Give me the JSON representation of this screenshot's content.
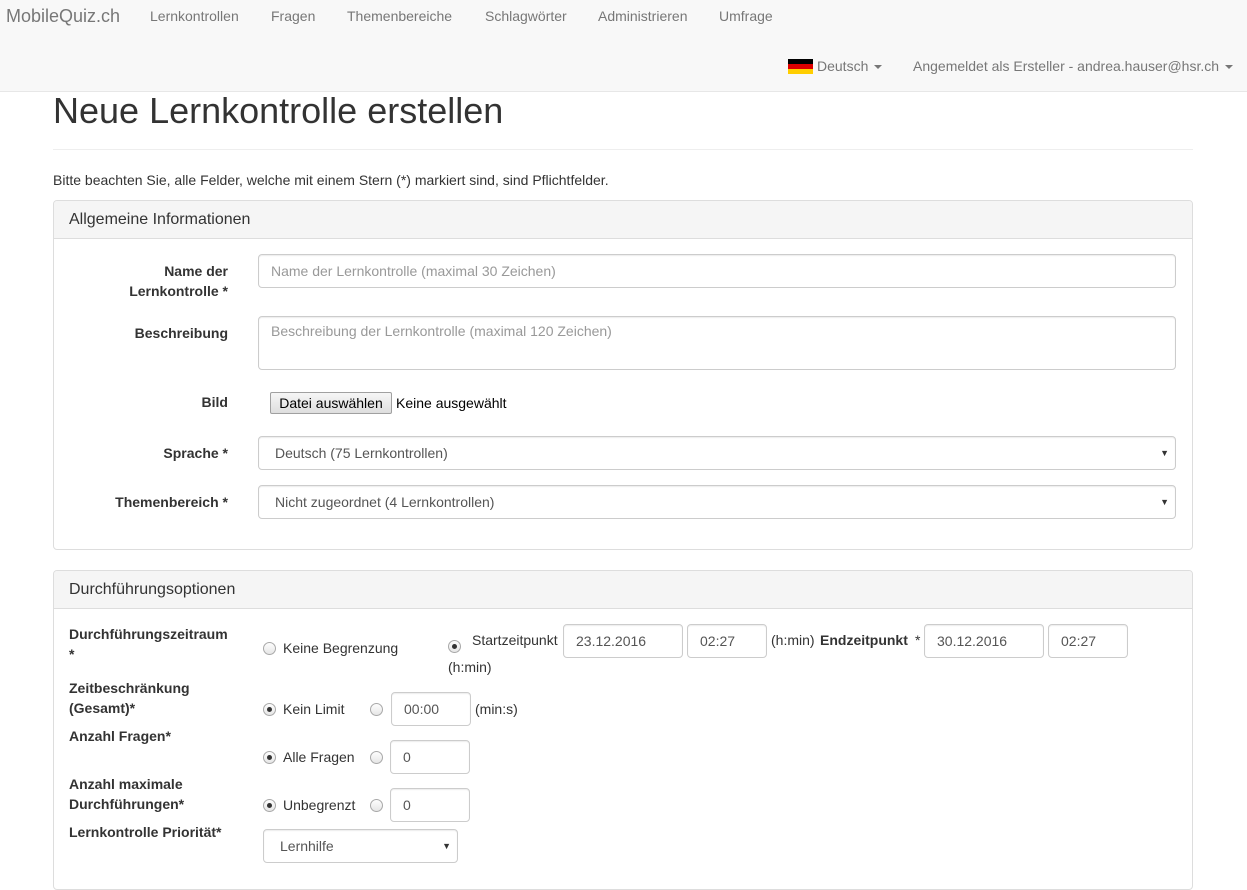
{
  "navbar": {
    "brand": "MobileQuiz.ch",
    "links": [
      "Lernkontrollen",
      "Fragen",
      "Themenbereiche",
      "Schlagwörter",
      "Administrieren",
      "Umfrage"
    ],
    "language": "Deutsch",
    "user": "Angemeldet als Ersteller - andrea.hauser@hsr.ch"
  },
  "page": {
    "title": "Neue Lernkontrolle erstellen",
    "notice": "Bitte beachten Sie, alle Felder, welche mit einem Stern (*) markiert sind, sind Pflichtfelder."
  },
  "general": {
    "heading": "Allgemeine Informationen",
    "name_label_line1": "Name der",
    "name_label_line2": "Lernkontrolle *",
    "name_placeholder": "Name der Lernkontrolle (maximal 30 Zeichen)",
    "description_label": "Beschreibung",
    "description_placeholder": "Beschreibung der Lernkontrolle (maximal 120 Zeichen)",
    "image_label": "Bild",
    "file_button": "Datei auswählen",
    "file_status": "Keine ausgewählt",
    "language_label": "Sprache *",
    "language_value": "Deutsch (75 Lernkontrollen)",
    "topic_label": "Themenbereich *",
    "topic_value": "Nicht zugeordnet (4 Lernkontrollen)"
  },
  "options": {
    "heading": "Durchführungsoptionen",
    "period_label_line1": "Durchführungszeitraum",
    "period_label_line2": "*",
    "no_limit_option": "Keine Begrenzung",
    "start_label": "Startzeitpunkt",
    "start_date": "23.12.2016",
    "start_time": "02:27",
    "hmin_1": "(h:min)",
    "end_label": "Endzeitpunkt",
    "end_star": "*",
    "end_date": "30.12.2016",
    "end_time": "02:27",
    "hmin_2": "(h:min)",
    "time_limit_label_line1": "Zeitbeschränkung",
    "time_limit_label_line2": "(Gesamt)*",
    "no_time_limit_option": "Kein Limit",
    "time_limit_value": "00:00",
    "time_limit_unit": "(min:s)",
    "question_count_label": "Anzahl Fragen*",
    "all_questions_option": "Alle Fragen",
    "question_count_value": "0",
    "max_runs_label_line1": "Anzahl maximale",
    "max_runs_label_line2": "Durchführungen*",
    "unlimited_option": "Unbegrenzt",
    "max_runs_value": "0",
    "priority_label": "Lernkontrolle Priorität*",
    "priority_value": "Lernhilfe"
  },
  "icons": {
    "flag": "flag-de-icon",
    "caret": "caret-down-icon",
    "select_arrow": "select-arrow-icon"
  },
  "colors": {
    "navbar_bg": "#f8f8f8",
    "nav_text": "#777777",
    "panel_heading_bg": "#f5f5f5",
    "border": "#dddddd",
    "placeholder": "#999999"
  }
}
